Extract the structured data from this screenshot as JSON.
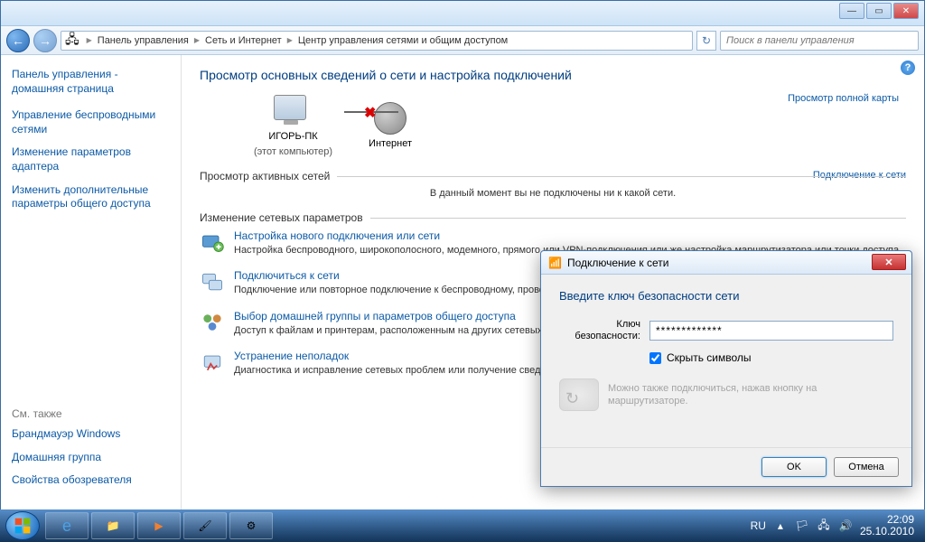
{
  "breadcrumb": {
    "items": [
      "Панель управления",
      "Сеть и Интернет",
      "Центр управления сетями и общим доступом"
    ]
  },
  "search": {
    "placeholder": "Поиск в панели управления"
  },
  "sidebar": {
    "home": "Панель управления - домашняя страница",
    "links": [
      "Управление беспроводными сетями",
      "Изменение параметров адаптера",
      "Изменить дополнительные параметры общего доступа"
    ],
    "seealso_title": "См. также",
    "seealso": [
      "Брандмауэр Windows",
      "Домашняя группа",
      "Свойства обозревателя"
    ]
  },
  "main": {
    "heading": "Просмотр основных сведений о сети и настройка подключений",
    "fullmap": "Просмотр полной карты",
    "node_pc": "ИГОРЬ-ПК",
    "node_pc_sub": "(этот компьютер)",
    "node_internet": "Интернет",
    "section_active": "Просмотр активных сетей",
    "connect_link": "Подключение к сети",
    "nonet": "В данный момент вы не подключены ни к какой сети.",
    "section_change": "Изменение сетевых параметров",
    "tasks": [
      {
        "title": "Настройка нового подключения или сети",
        "desc": "Настройка беспроводного, широкополосного, модемного, прямого или VPN-подключения или же настройка маршрутизатора или точки доступа."
      },
      {
        "title": "Подключиться к сети",
        "desc": "Подключение или повторное подключение к беспроводному, проводному, модемному сетевому соединению или подключение к VPN."
      },
      {
        "title": "Выбор домашней группы и параметров общего доступа",
        "desc": "Доступ к файлам и принтерам, расположенным на других сетевых компьютерах, или изменение параметров общего доступа."
      },
      {
        "title": "Устранение неполадок",
        "desc": "Диагностика и исправление сетевых проблем или получение сведений об исправлении."
      }
    ]
  },
  "dialog": {
    "title": "Подключение к сети",
    "heading": "Введите ключ безопасности сети",
    "key_label": "Ключ безопасности:",
    "key_value": "*************",
    "hide_chars": "Скрыть символы",
    "hint": "Можно также подключиться, нажав кнопку на маршрутизаторе.",
    "ok": "OK",
    "cancel": "Отмена"
  },
  "tray": {
    "lang": "RU",
    "time": "22:09",
    "date": "25.10.2010"
  }
}
